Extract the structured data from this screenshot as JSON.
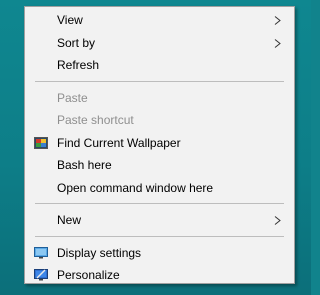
{
  "menu": {
    "items": [
      {
        "label": "View"
      },
      {
        "label": "Sort by"
      },
      {
        "label": "Refresh"
      },
      {
        "label": "Paste"
      },
      {
        "label": "Paste shortcut"
      },
      {
        "label": "Find Current Wallpaper",
        "icon": "wallpaper-icon"
      },
      {
        "label": "Bash here"
      },
      {
        "label": "Open command window here"
      },
      {
        "label": "New"
      },
      {
        "label": "Display settings",
        "icon": "display-icon"
      },
      {
        "label": "Personalize",
        "icon": "personalize-icon"
      }
    ]
  },
  "colors": {
    "desktop": "#0f8790",
    "menu_background": "#f2f2f2",
    "disabled_text": "#8f8f8f",
    "separator": "#bdbdbd"
  }
}
